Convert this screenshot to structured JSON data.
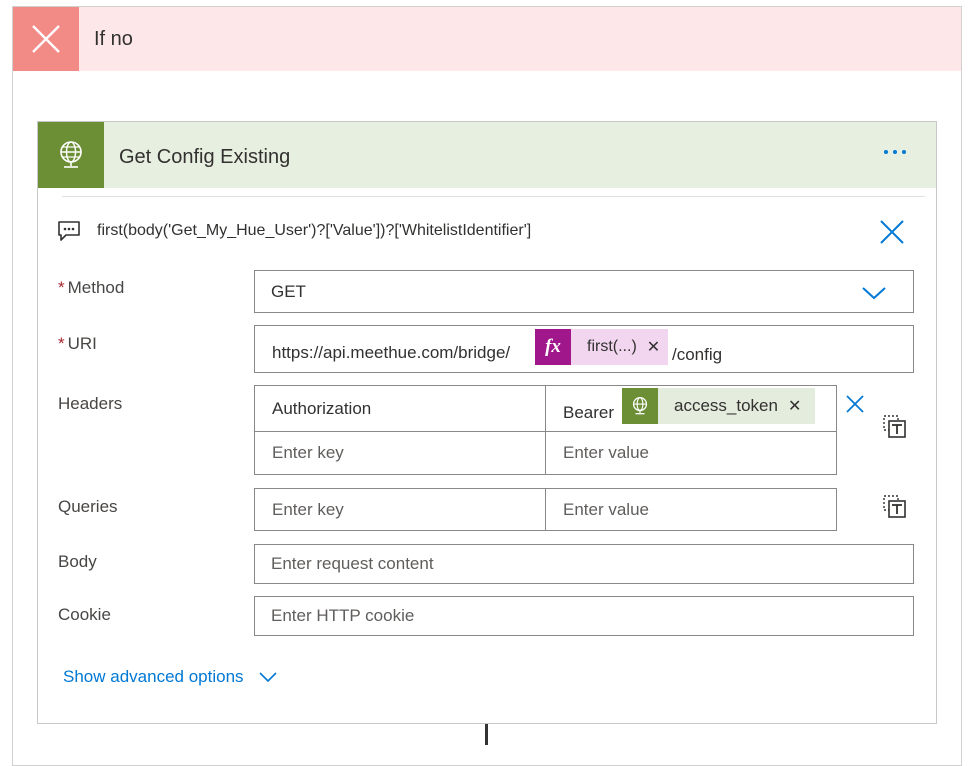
{
  "condition": {
    "title": "If no"
  },
  "action": {
    "title": "Get Config Existing",
    "comment": "first(body('Get_My_Hue_User')?['Value'])?['WhitelistIdentifier']",
    "method": {
      "label": "Method",
      "required_mark": "*",
      "value": "GET"
    },
    "uri": {
      "label": "URI",
      "required_mark": "*",
      "prefix": "https://api.meethue.com/bridge/",
      "token_text": "first(...)",
      "token_icon": "fx",
      "suffix": "/config"
    },
    "headers": {
      "label": "Headers",
      "rows": [
        {
          "key": "Authorization",
          "value_prefix": "Bearer",
          "value_token": "access_token"
        }
      ],
      "key_placeholder": "Enter key",
      "value_placeholder": "Enter value"
    },
    "queries": {
      "label": "Queries",
      "key_placeholder": "Enter key",
      "value_placeholder": "Enter value"
    },
    "body": {
      "label": "Body",
      "placeholder": "Enter request content"
    },
    "cookie": {
      "label": "Cookie",
      "placeholder": "Enter HTTP cookie"
    },
    "advanced": {
      "label": "Show advanced options"
    }
  },
  "colors": {
    "condition_header_bg": "#fde7e9",
    "condition_icon_bg": "#f28b85",
    "action_header_bg": "#e7efe1",
    "action_icon_bg": "#6c8e34",
    "fx_token_bg": "#f2d6ef",
    "fx_icon_bg": "#a0168b",
    "accent": "#0078d4"
  },
  "icons": {
    "condition": "close-icon",
    "action": "globe-icon",
    "comment": "comment-icon",
    "more": "more-icon",
    "chevron": "chevron-down-icon",
    "text_mode": "switch-to-text-mode-icon"
  }
}
